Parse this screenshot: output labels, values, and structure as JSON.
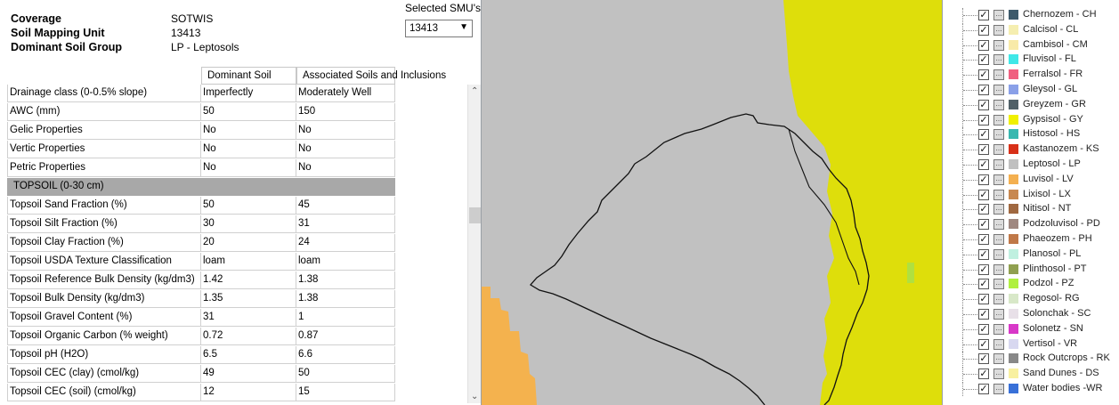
{
  "info": {
    "headers": [
      {
        "label": "Coverage",
        "value": "SOTWIS"
      },
      {
        "label": "Soil Mapping Unit",
        "value": "13413"
      },
      {
        "label": "Dominant Soil Group",
        "value": "LP - Leptosols"
      }
    ],
    "smu_title": "Selected SMU's",
    "smu_selected": "13413",
    "columns": [
      "Dominant Soil",
      "Associated Soils and Inclusions"
    ],
    "rows": [
      {
        "label": "Drainage class (0-0.5% slope)",
        "dominant": "Imperfectly",
        "associated": "Moderately Well"
      },
      {
        "label": "AWC (mm)",
        "dominant": "50",
        "associated": "150"
      },
      {
        "label": "Gelic Properties",
        "dominant": "No",
        "associated": "No"
      },
      {
        "label": "Vertic Properties",
        "dominant": "No",
        "associated": "No"
      },
      {
        "label": "Petric Properties",
        "dominant": "No",
        "associated": "No"
      },
      {
        "label": "TOPSOIL (0-30 cm)",
        "dominant": "",
        "associated": "",
        "section": true
      },
      {
        "label": "Topsoil Sand Fraction (%)",
        "dominant": "50",
        "associated": "45"
      },
      {
        "label": "Topsoil Silt Fraction (%)",
        "dominant": "30",
        "associated": "31"
      },
      {
        "label": "Topsoil Clay Fraction (%)",
        "dominant": "20",
        "associated": "24"
      },
      {
        "label": "Topsoil USDA Texture Classification",
        "dominant": "loam",
        "associated": "loam"
      },
      {
        "label": "Topsoil Reference Bulk Density (kg/dm3)",
        "dominant": "1.42",
        "associated": "1.38"
      },
      {
        "label": "Topsoil Bulk Density (kg/dm3)",
        "dominant": "1.35",
        "associated": "1.38"
      },
      {
        "label": "Topsoil Gravel Content (%)",
        "dominant": "31",
        "associated": "1"
      },
      {
        "label": "Topsoil Organic  Carbon (% weight)",
        "dominant": "0.72",
        "associated": "0.87"
      },
      {
        "label": "Topsoil pH (H2O)",
        "dominant": "6.5",
        "associated": "6.6"
      },
      {
        "label": "Topsoil CEC (clay) (cmol/kg)",
        "dominant": "49",
        "associated": "50"
      },
      {
        "label": "Topsoil CEC (soil) (cmol/kg)",
        "dominant": "12",
        "associated": "15"
      }
    ]
  },
  "legend": {
    "items": [
      {
        "label": "Chernozem - CH",
        "color": "#3d5a6b"
      },
      {
        "label": "Calcisol - CL",
        "color": "#f5eeb0"
      },
      {
        "label": "Cambisol - CM",
        "color": "#f8eaa8"
      },
      {
        "label": "Fluvisol - FL",
        "color": "#40e8e8"
      },
      {
        "label": "Ferralsol - FR",
        "color": "#f06080"
      },
      {
        "label": "Gleysol - GL",
        "color": "#8aa0e8"
      },
      {
        "label": "Greyzem - GR",
        "color": "#506068"
      },
      {
        "label": "Gypsisol - GY",
        "color": "#f0f000"
      },
      {
        "label": "Histosol - HS",
        "color": "#38b8b0"
      },
      {
        "label": "Kastanozem - KS",
        "color": "#d83018"
      },
      {
        "label": "Leptosol - LP",
        "color": "#c0c0c0"
      },
      {
        "label": "Luvisol - LV",
        "color": "#f4b050"
      },
      {
        "label": "Lixisol - LX",
        "color": "#c88850"
      },
      {
        "label": "Nitisol - NT",
        "color": "#a06840"
      },
      {
        "label": "Podzoluvisol - PD",
        "color": "#a08880"
      },
      {
        "label": "Phaeozem - PH",
        "color": "#c07848"
      },
      {
        "label": "Planosol - PL",
        "color": "#c0f0e0"
      },
      {
        "label": "Plinthosol - PT",
        "color": "#90a050"
      },
      {
        "label": "Podzol - PZ",
        "color": "#b0f040"
      },
      {
        "label": "Regosol- RG",
        "color": "#d8e8c8"
      },
      {
        "label": "Solonchak - SC",
        "color": "#e8e0e8"
      },
      {
        "label": "Solonetz - SN",
        "color": "#d838c8"
      },
      {
        "label": "Vertisol - VR",
        "color": "#d8d8f0"
      },
      {
        "label": "Rock Outcrops - RK",
        "color": "#888888"
      },
      {
        "label": "Sand Dunes - DS",
        "color": "#f8f0a0"
      },
      {
        "label": "Water bodies -WR",
        "color": "#3870d8"
      }
    ]
  },
  "map": {
    "colors": {
      "background": "#c1c1c1",
      "gypsisol": "#dede0b",
      "luvisol": "#f4b24e"
    }
  }
}
